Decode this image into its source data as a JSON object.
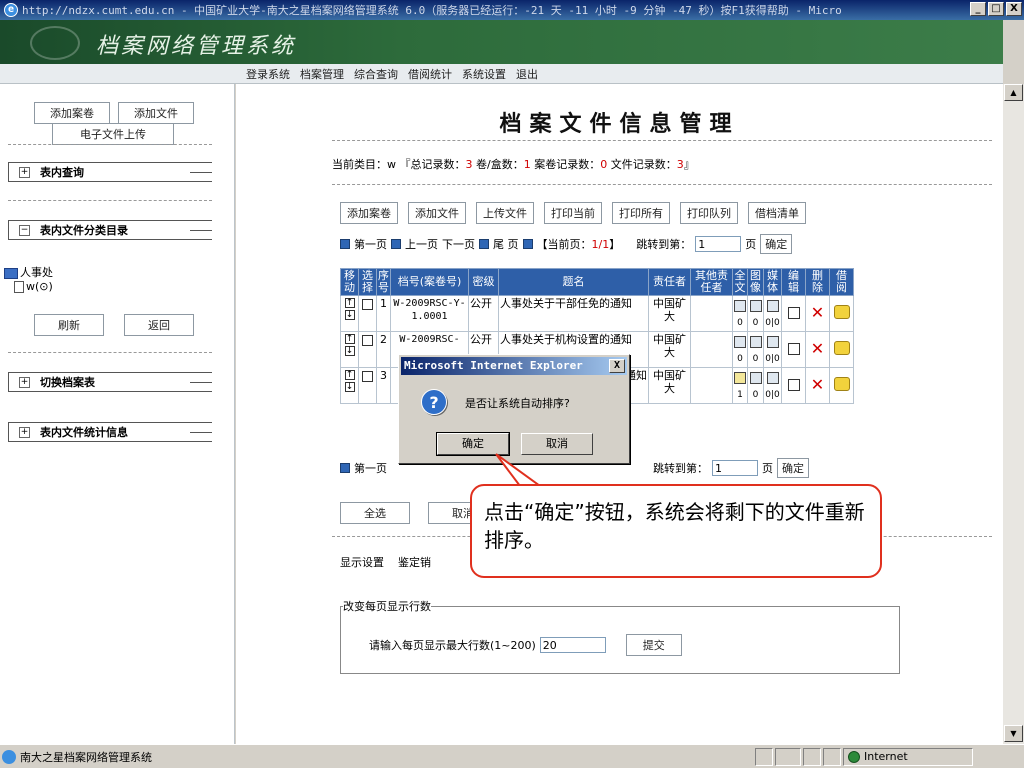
{
  "window": {
    "title": "http://ndzx.cumt.edu.cn - 中国矿业大学-南大之星档案网络管理系统 6.0（服务器已经运行：-21 天 -11 小时 -9 分钟 -47 秒）按F1获得帮助 - Micro",
    "min": "_",
    "max": "□",
    "close": "X"
  },
  "banner": {
    "app_title": "档案网络管理系统"
  },
  "menu": [
    "登录系统",
    "档案管理",
    "综合查询",
    "借阅统计",
    "系统设置",
    "退出"
  ],
  "left": {
    "add_volume": "添加案卷",
    "add_file": "添加文件",
    "upload": "电子文件上传",
    "groups": {
      "search": "表内查询",
      "catalog": "表内文件分类目录",
      "switch": "切换档案表",
      "stats": "表内文件统计信息"
    },
    "tree": {
      "root": "人事处",
      "child": "w(⊙)"
    },
    "refresh": "刷新",
    "back": "返回"
  },
  "main": {
    "title": "档案文件信息管理",
    "category_prefix": "当前类目：w 『总记录数：",
    "total": "3",
    "box_label": " 卷/盒数：",
    "boxes": "1",
    "vol_label": " 案卷记录数：",
    "vol_records": "0",
    "file_label": " 文件记录数：",
    "file_records": "3",
    "category_suffix": "』",
    "toolbar": [
      "添加案卷",
      "添加文件",
      "上传文件",
      "打印当前",
      "打印所有",
      "打印队列",
      "借档清单"
    ],
    "pager": {
      "first": "第一页",
      "prev": "上一页",
      "next": "下一页",
      "last": "尾 页",
      "current_label": "【当前页：",
      "current": "1/1",
      "current_end": "】",
      "jump_label": "跳转到第：",
      "jump_value": "1",
      "page_unit": "页",
      "confirm": "确定"
    },
    "table": {
      "headers": [
        "移动",
        "选择",
        "序号",
        "档号(案卷号)",
        "密级",
        "题名",
        "责任者",
        "其他责任者",
        "全文",
        "图像",
        "媒体",
        "编辑",
        "删除",
        "借阅"
      ],
      "rows": [
        {
          "no": "1",
          "code": "W-2009RSC-Y-1.0001",
          "secret": "公开",
          "title": "人事处关于干部任免的通知",
          "owner": "中国矿大",
          "fulltext": "0",
          "image": "0",
          "media": "0|0"
        },
        {
          "no": "2",
          "code": "W-2009RSC-",
          "secret": "公开",
          "title": "人事处关于机构设置的通知",
          "owner": "中国矿大",
          "fulltext": "0",
          "image": "0",
          "media": "0|0"
        },
        {
          "no": "3",
          "code": "",
          "secret": "",
          "title": "通知",
          "owner": "中国矿大",
          "fulltext": "1",
          "image": "0",
          "media": "0|0"
        }
      ]
    },
    "bottom_pager_first": "第一页",
    "bottom_buttons": [
      "全选",
      "取消"
    ],
    "settings": [
      "显示设置",
      "鉴定销"
    ],
    "rows_legend": "改变每页显示行数",
    "rows_prompt": "请输入每页显示最大行数(1~200)",
    "rows_value": "20",
    "submit": "提交"
  },
  "dialog": {
    "title": "Microsoft Internet Explorer",
    "message": "是否让系统自动排序?",
    "ok": "确定",
    "cancel": "取消",
    "close": "X"
  },
  "callout": {
    "text": "点击“确定”按钮，系统会将剩下的文件重新排序。"
  },
  "status": {
    "text": "南大之星档案网络管理系统",
    "zone": "Internet"
  }
}
